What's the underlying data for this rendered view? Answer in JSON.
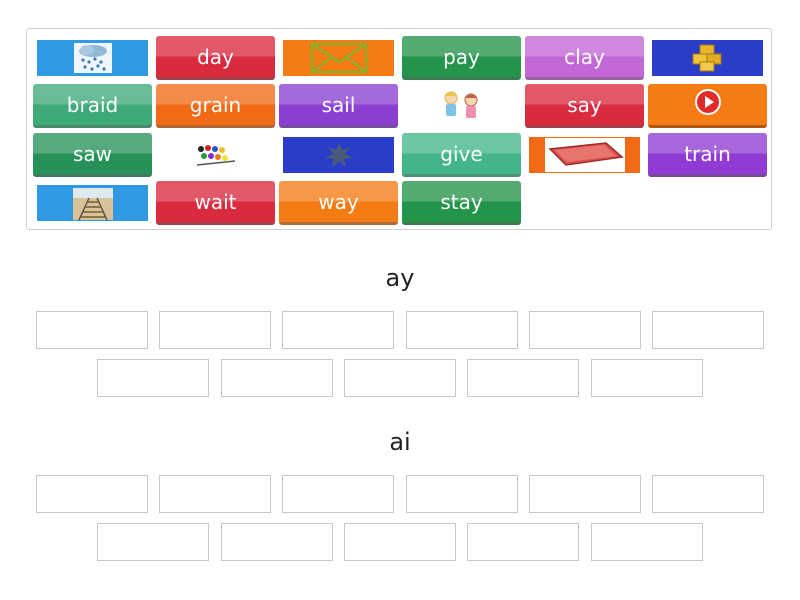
{
  "tiles": {
    "r1c2": "day",
    "r1c4": "pay",
    "r1c5": "clay",
    "r2c1": "braid",
    "r2c2": "grain",
    "r2c3": "sail",
    "r2c5": "say",
    "r3c1": "saw",
    "r3c4": "give",
    "r3c6": "train",
    "r4c2": "wait",
    "r4c3": "way",
    "r4c4": "stay"
  },
  "image_tiles": {
    "r1c1": "rain-cloud-image",
    "r1c3": "envelope-mail-image",
    "r1c6": "hay-bales-image",
    "r2c4": "children-playing-image",
    "r2c6": "play-button-icon",
    "r3c2": "paint-palette-image",
    "r3c3": "paint-splat-image",
    "r3c5": "tray-image",
    "r4c1": "railway-track-image"
  },
  "groups": {
    "ay": "ay",
    "ai": "ai"
  },
  "colors": {
    "blue": "#2f9ae3",
    "red": "#d92a3e",
    "orange": "#f57b14",
    "green": "#23944a",
    "lilac": "#c367d6",
    "navy": "#2a3dc9",
    "mint": "#3daa78",
    "purple": "#8a3fd0"
  }
}
